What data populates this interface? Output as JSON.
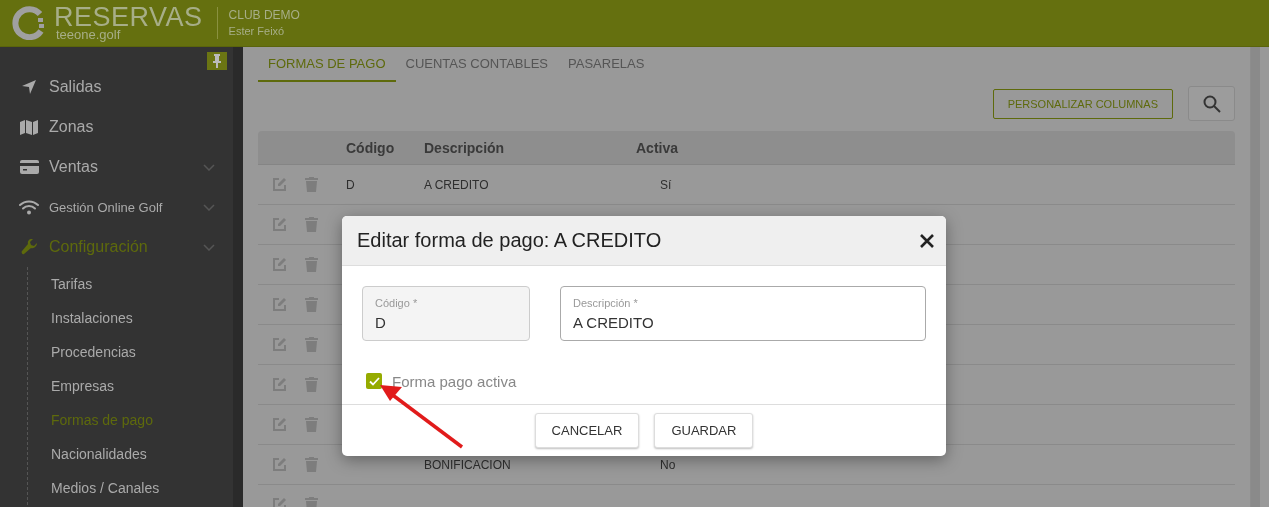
{
  "header": {
    "logo_title": "RESERVAS",
    "logo_subtitle": "teeone.golf",
    "club": "CLUB DEMO",
    "user": "Ester Feixó"
  },
  "sidebar": {
    "pinned": true,
    "items": [
      {
        "kind": "send",
        "label": "Salidas",
        "expandable": false,
        "selected": false
      },
      {
        "kind": "map",
        "label": "Zonas",
        "expandable": false,
        "selected": false
      },
      {
        "kind": "card",
        "label": "Ventas",
        "expandable": true,
        "selected": false
      },
      {
        "kind": "wifi",
        "label": "Gestión Online Golf",
        "expandable": true,
        "selected": false
      },
      {
        "kind": "wrench",
        "label": "Configuración",
        "expandable": true,
        "selected": true,
        "children": [
          {
            "label": "Tarifas",
            "selected": false
          },
          {
            "label": "Instalaciones",
            "selected": false
          },
          {
            "label": "Procedencias",
            "selected": false
          },
          {
            "label": "Empresas",
            "selected": false
          },
          {
            "label": "Formas de pago",
            "selected": true
          },
          {
            "label": "Nacionalidades",
            "selected": false
          },
          {
            "label": "Medios / Canales",
            "selected": false
          }
        ]
      }
    ]
  },
  "tabs": [
    {
      "label": "FORMAS DE PAGO",
      "selected": true
    },
    {
      "label": "CUENTAS CONTABLES",
      "selected": false
    },
    {
      "label": "PASARELAS",
      "selected": false
    }
  ],
  "toolbar": {
    "button": "PERSONALIZAR COLUMNAS"
  },
  "table": {
    "columns": [
      "Código",
      "Descripción",
      "Activa"
    ],
    "rows": [
      {
        "codigo": "D",
        "descripcion": "A CREDITO",
        "activa": "Sí"
      },
      {},
      {},
      {},
      {},
      {},
      {},
      {
        "descripcion": "BONIFICACION",
        "activa": "No"
      },
      {}
    ]
  },
  "modal": {
    "title": "Editar forma de pago: A CREDITO",
    "fields": [
      {
        "label": "Código *",
        "value": "D",
        "disabled": true
      },
      {
        "label": "Descripción *",
        "value": "A CREDITO",
        "disabled": false
      }
    ],
    "checkbox": {
      "label": "Forma pago activa",
      "checked": true
    },
    "buttons": [
      "CANCELAR",
      "GUARDAR"
    ]
  }
}
